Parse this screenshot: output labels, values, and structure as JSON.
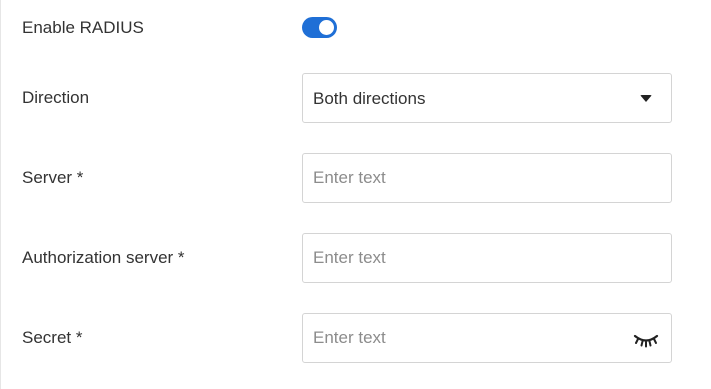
{
  "radius": {
    "enable_label": "Enable RADIUS",
    "enabled": true
  },
  "direction": {
    "label": "Direction",
    "value": "Both directions",
    "icon": "caret-down-icon"
  },
  "server": {
    "label": "Server *",
    "placeholder": "Enter text"
  },
  "auth_server": {
    "label": "Authorization server *",
    "placeholder": "Enter text"
  },
  "secret": {
    "label": "Secret *",
    "placeholder": "Enter text",
    "icon": "eye-closed-icon"
  },
  "colors": {
    "accent": "#1f6fd6",
    "text": "#333333",
    "placeholder": "#8c8c8c",
    "border": "#d4d4d4"
  }
}
